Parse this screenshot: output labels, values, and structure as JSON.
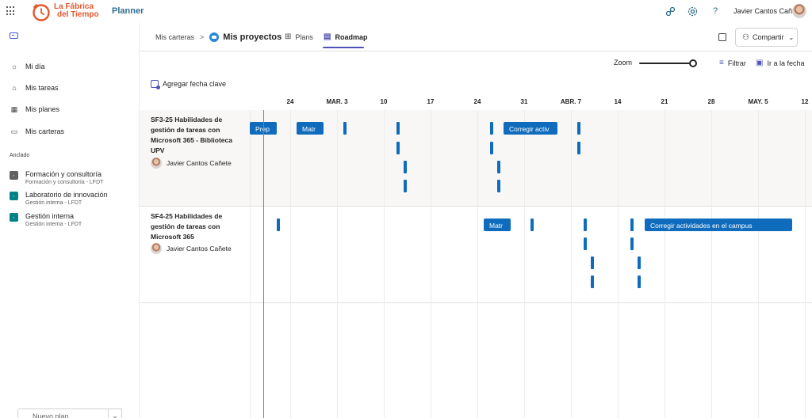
{
  "topbar": {
    "brand_line1": "La Fábrica",
    "brand_line2": "del Tiempo",
    "app_name": "Planner",
    "user_name": "Javier Cantos Cañ...",
    "icons": [
      "waffle-icon",
      "link-icon",
      "settings-icon",
      "help-icon"
    ],
    "brand_color": "#e4572e",
    "accent_color": "#2f6f8f"
  },
  "sidebar": {
    "items": [
      {
        "label": "Mi día",
        "icon": "sun-icon"
      },
      {
        "label": "Mis tareas",
        "icon": "home-icon"
      },
      {
        "label": "Mis planes",
        "icon": "grid-icon"
      },
      {
        "label": "Mis carteras",
        "icon": "folder-icon"
      }
    ],
    "pinned_label": "Anclado",
    "pinned": [
      {
        "title": "Formación y consultoría",
        "subtitle": "Formación y consultoría - LFDT",
        "color": "#616161"
      },
      {
        "title": "Laboratorio de innovación",
        "subtitle": "Gestión interna - LFDT",
        "color": "#038387"
      },
      {
        "title": "Gestión interna",
        "subtitle": "Gestión interna - LFDT",
        "color": "#038387"
      }
    ],
    "new_plan_label": "Nuevo plan"
  },
  "header": {
    "breadcrumb_parent": "Mis carteras",
    "breadcrumb_sep": ">",
    "project_title": "Mis proyectos",
    "tabs": [
      {
        "label": "Plans",
        "icon": "board-icon"
      },
      {
        "label": "Roadmap",
        "icon": "roadmap-icon"
      }
    ],
    "share_label": "Compartir"
  },
  "toolbar": {
    "zoom_label": "Zoom",
    "zoom_level": 1.0,
    "filter_label": "Filtrar",
    "goto_label": "Ir a la fecha",
    "add_key_date_label": "Agregar fecha clave"
  },
  "timeline": {
    "dates": [
      "24",
      "MAR. 3",
      "10",
      "17",
      "24",
      "31",
      "ABR. 7",
      "14",
      "21",
      "28",
      "MAY. 5",
      "12"
    ],
    "bar_color": "#0f6cbd",
    "today_color": "#e05a5a",
    "lanes": [
      {
        "title": "SF3-25 Habilidades de gestión de tareas con Microsoft 365 - Biblioteca UPV",
        "owner": "Javier Cantos Cañete",
        "bars": [
          {
            "label": "Prep"
          },
          {
            "label": "Matr"
          },
          {
            "label": "Corregir activ"
          }
        ]
      },
      {
        "title": "SF4-25 Habilidades de gestión de tareas con Microsoft 365",
        "owner": "Javier Cantos Cañete",
        "bars": [
          {
            "label": "Matr"
          },
          {
            "label": "Corregir actividades en el campus"
          }
        ]
      }
    ]
  }
}
